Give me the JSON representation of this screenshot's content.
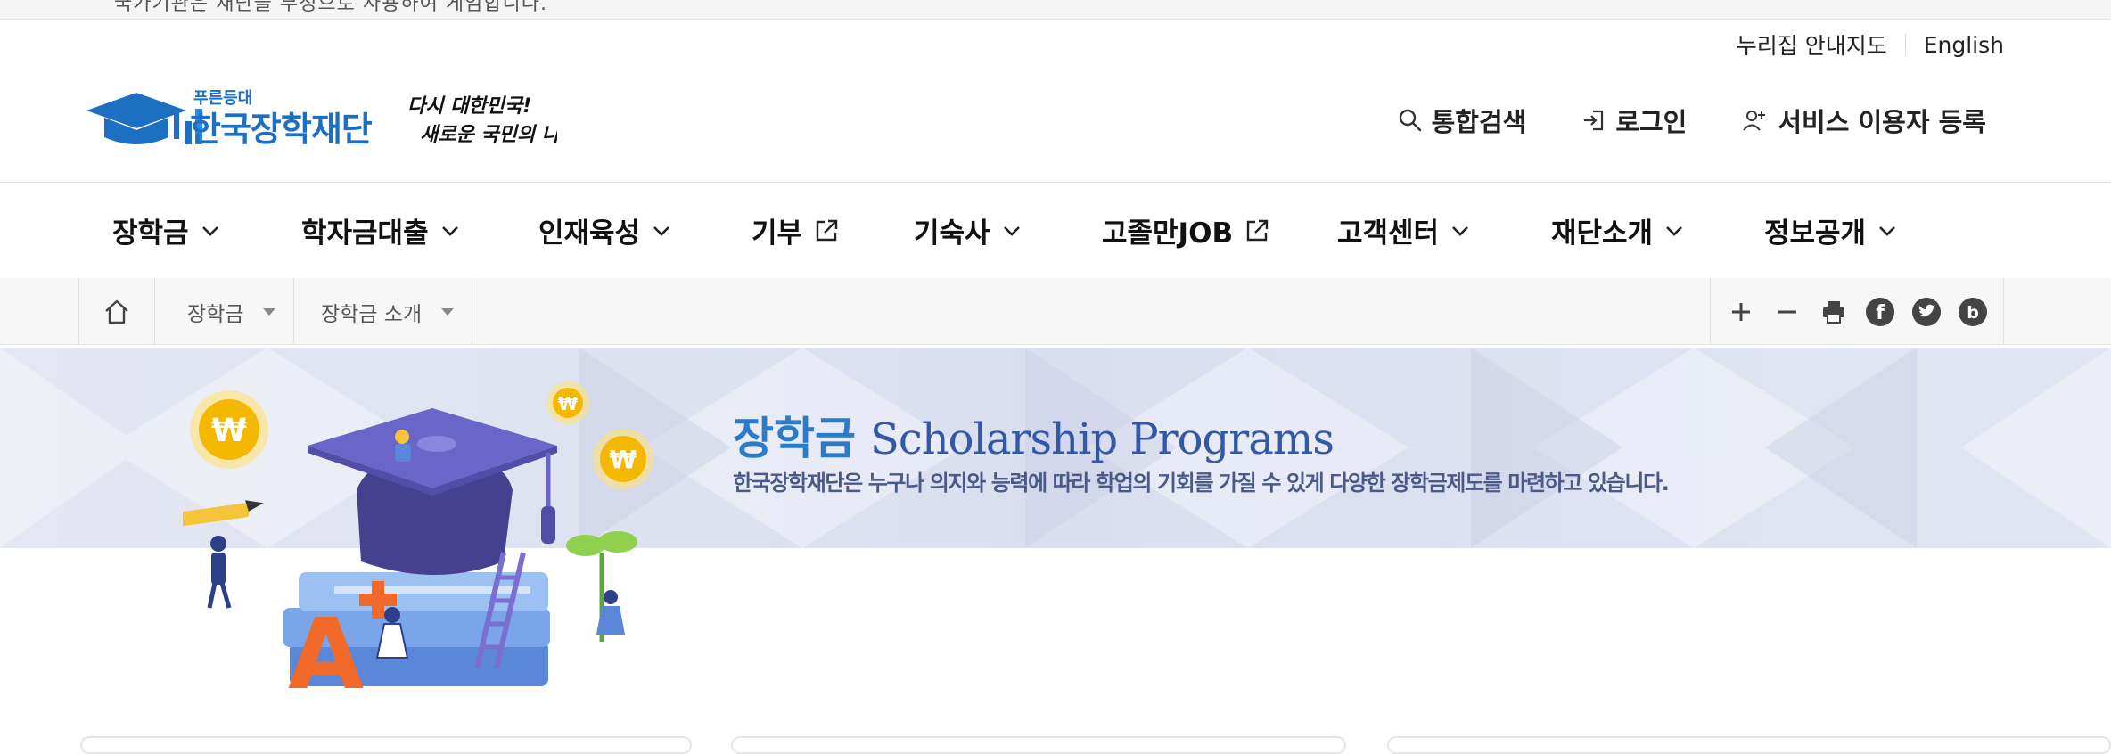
{
  "top_notice": "국가기관은 재단을 부정으로 사용하여 게임합니다.",
  "util_links": {
    "site_map": "누리집 안내지도",
    "english": "English"
  },
  "logo": {
    "small": "푸른등대",
    "name": "한국장학재단",
    "slogan1": "다시 대한민국!",
    "slogan2": "새로운 국민의 나라"
  },
  "header_actions": {
    "search": "통합검색",
    "login": "로그인",
    "register": "서비스 이용자 등록"
  },
  "gnb": [
    {
      "label": "장학금",
      "icon": "chevron-down-icon"
    },
    {
      "label": "학자금대출",
      "icon": "chevron-down-icon"
    },
    {
      "label": "인재육성",
      "icon": "chevron-down-icon"
    },
    {
      "label": "기부",
      "icon": "external-link-icon"
    },
    {
      "label": "기숙사",
      "icon": "chevron-down-icon"
    },
    {
      "label": "고졸만JOB",
      "icon": "external-link-icon"
    },
    {
      "label": "고객센터",
      "icon": "chevron-down-icon"
    },
    {
      "label": "재단소개",
      "icon": "chevron-down-icon"
    },
    {
      "label": "정보공개",
      "icon": "chevron-down-icon"
    }
  ],
  "breadcrumb": {
    "level1": "장학금",
    "level2": "장학금 소개"
  },
  "tools": [
    "plus-icon",
    "minus-icon",
    "print-icon",
    "facebook-icon",
    "twitter-icon",
    "blog-icon"
  ],
  "banner": {
    "title_ko": "장학금",
    "title_en": "Scholarship Programs",
    "subtitle": "한국장학재단은 누구나 의지와 능력에 따라 학업의 기회를 가질 수 있게 다양한 장학금제도를 마련하고 있습니다."
  },
  "colors": {
    "brand_blue": "#2a7bc8",
    "title_navy": "#3457a6",
    "banner_bg": "#dfe3f1",
    "coin": "#f5b800"
  }
}
